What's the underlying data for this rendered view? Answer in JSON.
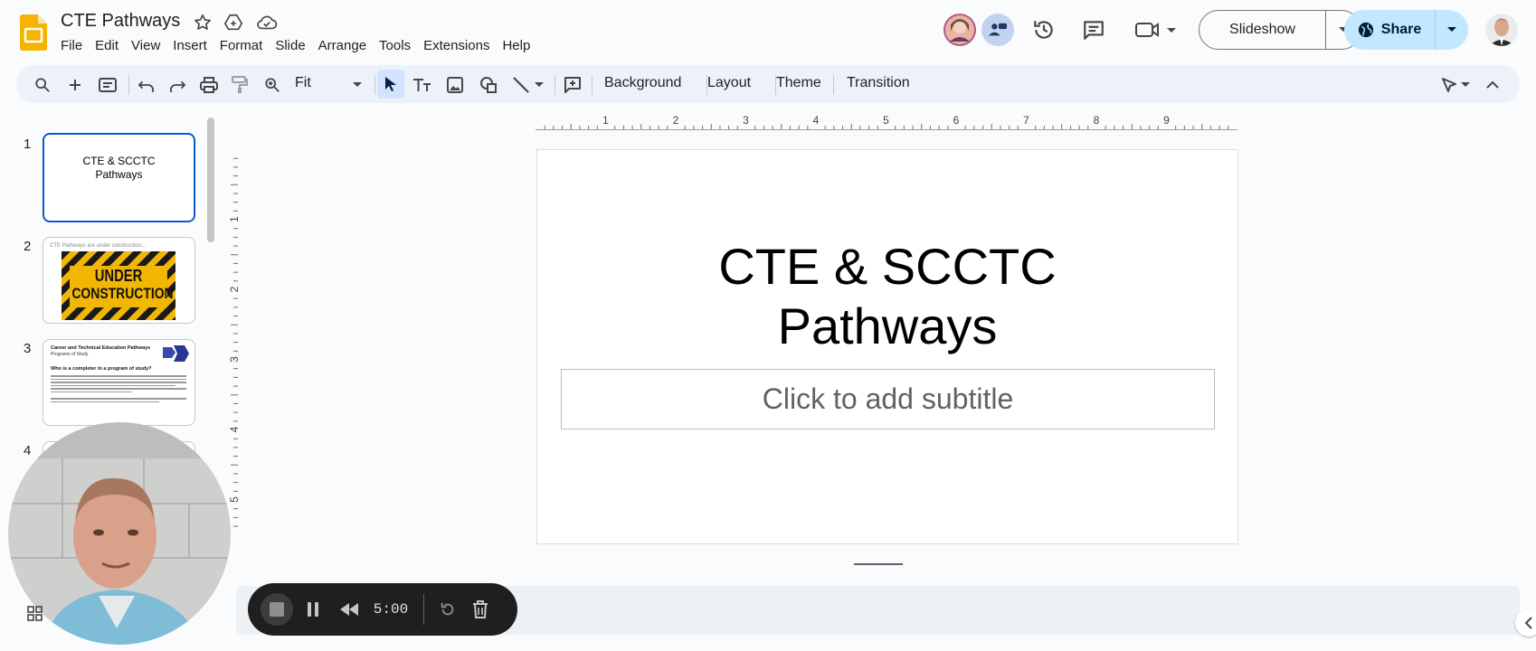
{
  "app": {
    "title": "CTE Pathways",
    "menu": [
      "File",
      "Edit",
      "View",
      "Insert",
      "Format",
      "Slide",
      "Arrange",
      "Tools",
      "Extensions",
      "Help"
    ]
  },
  "header": {
    "slideshow_label": "Slideshow",
    "share_label": "Share"
  },
  "toolbar": {
    "zoom_value": "Fit",
    "background_label": "Background",
    "layout_label": "Layout",
    "theme_label": "Theme",
    "transition_label": "Transition"
  },
  "ruler": {
    "horizontal": [
      "1",
      "2",
      "3",
      "4",
      "5",
      "6",
      "7",
      "8",
      "9"
    ],
    "vertical": [
      "1",
      "2",
      "3",
      "4",
      "5"
    ]
  },
  "filmstrip": {
    "slides": [
      {
        "number": "1",
        "title": "CTE & SCCTC Pathways"
      },
      {
        "number": "2",
        "caption": "CTE Pathways are under construction...",
        "sign_line1": "UNDER",
        "sign_line2": "CONSTRUCTION"
      },
      {
        "number": "3",
        "heading": "Career and Technical Education Pathways",
        "subheading": "Programs of Study",
        "question": "Who is a completer in a program of study?"
      },
      {
        "number": "4"
      }
    ]
  },
  "slide": {
    "title_line1": "CTE & SCCTC",
    "title_line2": "Pathways",
    "subtitle_placeholder": "Click to add subtitle"
  },
  "recorder": {
    "time": "5:00"
  },
  "colors": {
    "accent": "#0b57d0",
    "share_bg": "#c2e7ff",
    "toolbar_bg": "#edf2fa",
    "logo": "#f4b400"
  }
}
